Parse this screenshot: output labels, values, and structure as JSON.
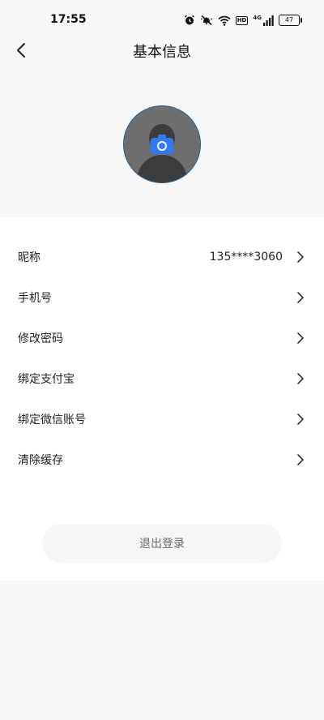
{
  "status_bar": {
    "time": "17:55",
    "network_type": "4G",
    "hd_badge": "HD",
    "battery": "47"
  },
  "header": {
    "title": "基本信息"
  },
  "list": {
    "items": [
      {
        "label": "昵称",
        "value": "135****3060"
      },
      {
        "label": "手机号",
        "value": ""
      },
      {
        "label": "修改密码",
        "value": ""
      },
      {
        "label": "绑定支付宝",
        "value": ""
      },
      {
        "label": "绑定微信账号",
        "value": ""
      },
      {
        "label": "清除缓存",
        "value": ""
      }
    ]
  },
  "logout": {
    "label": "退出登录"
  },
  "colors": {
    "background": "#f7f7f7",
    "card": "#ffffff",
    "camera": "#2f7cf6",
    "avatar_border": "#1f5d8f"
  },
  "icons": {
    "back": "chevron-left-icon",
    "item_arrow": "chevron-right-icon",
    "camera": "camera-icon",
    "alarm": "alarm-icon",
    "mute": "bell-off-icon",
    "wifi": "wifi-icon",
    "signal": "signal-icon"
  }
}
